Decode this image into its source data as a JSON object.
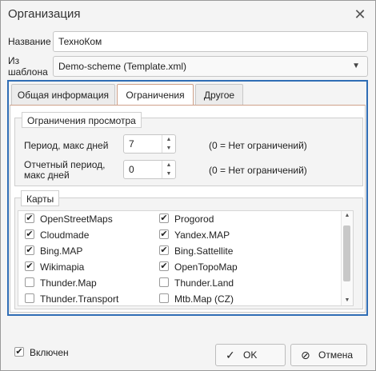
{
  "window": {
    "title": "Организация",
    "close_glyph": "✕"
  },
  "form": {
    "name_label": "Название",
    "name_value": "ТехноКом",
    "template_label_1": "Из",
    "template_label_2": "шаблона",
    "template_value": "Demo-scheme (Template.xml)"
  },
  "tabs": [
    {
      "label": "Общая информация",
      "active": false
    },
    {
      "label": "Ограничения",
      "active": true
    },
    {
      "label": "Другое",
      "active": false
    }
  ],
  "view_limits": {
    "legend": "Ограничения просмотра",
    "period_label": "Период, макс дней",
    "period_value": "7",
    "period_hint": "(0 = Нет ограничений)",
    "report_label_1": "Отчетный период,",
    "report_label_2": "макс дней",
    "report_value": "0",
    "report_hint": "(0 = Нет ограничений)"
  },
  "maps": {
    "legend": "Карты",
    "items": [
      {
        "label": "OpenStreetMaps",
        "checked": true
      },
      {
        "label": "Progorod",
        "checked": true
      },
      {
        "label": "Cloudmade",
        "checked": true
      },
      {
        "label": "Yandex.MAP",
        "checked": true
      },
      {
        "label": "Bing.MAP",
        "checked": true
      },
      {
        "label": "Bing.Sattellite",
        "checked": true
      },
      {
        "label": "Wikimapia",
        "checked": true
      },
      {
        "label": "OpenTopoMap",
        "checked": true
      },
      {
        "label": "Thunder.Map",
        "checked": false
      },
      {
        "label": "Thunder.Land",
        "checked": false
      },
      {
        "label": "Thunder.Transport",
        "checked": false
      },
      {
        "label": "Mtb.Map (CZ)",
        "checked": false
      }
    ]
  },
  "footer": {
    "enabled_label": "Включен",
    "enabled_checked": true,
    "ok_label": "OK",
    "cancel_label": "Отмена"
  },
  "colors": {
    "focus_border": "#2f6db5",
    "active_tab_border": "#cfa18a"
  }
}
